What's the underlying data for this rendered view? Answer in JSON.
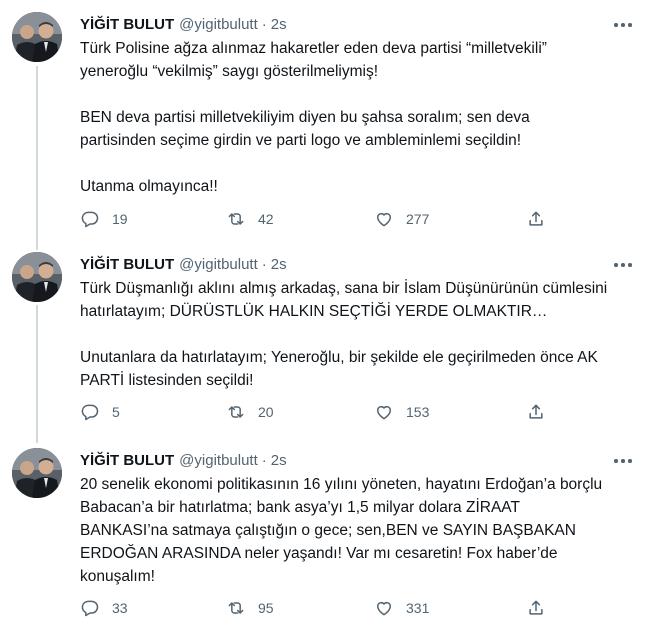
{
  "tweets": [
    {
      "name": "YİĞİT BULUT",
      "handle": "@yigitbulutt",
      "time": "2s",
      "lines": [
        "Türk Polisine ağza alınmaz hakaretler eden deva partisi “milletvekili”",
        "yeneroğlu “vekilmiş” saygı gösterilmeliymiş!",
        "",
        "BEN deva partisi milletvekiliyim diyen bu şahsa soralım; sen deva",
        "partisinden seçime girdin ve parti logo ve ambleminlemi seçildin!",
        "",
        "Utanma olmayınca!!"
      ],
      "replies": "19",
      "retweets": "42",
      "likes": "277"
    },
    {
      "name": "YİĞİT BULUT",
      "handle": "@yigitbulutt",
      "time": "2s",
      "lines": [
        "Türk Düşmanlığı aklını almış arkadaş, sana bir İslam Düşünürünün cümlesini",
        "hatırlatayım; DÜRÜSTLÜK HALKIN SEÇTİĞİ YERDE OLMAKTIR…",
        "",
        "Unutanlara da hatırlatayım; Yeneroğlu, bir şekilde ele geçirilmeden önce AK",
        "PARTİ listesinden seçildi!"
      ],
      "replies": "5",
      "retweets": "20",
      "likes": "153"
    },
    {
      "name": "YİĞİT BULUT",
      "handle": "@yigitbulutt",
      "time": "2s",
      "lines": [
        "20 senelik ekonomi politikasının 16 yılını yöneten, hayatını Erdoğan’a borçlu",
        "Babacan’a bir hatırlatma; bank asya’yı 1,5 milyar dolara ZİRAAT",
        "BANKASI’na satmaya çalıştığın o gece; sen,BEN ve SAYIN BAŞBAKAN",
        "ERDOĞAN ARASINDA neler yaşandı! Var mı cesaretin! Fox haber’de",
        "konuşalım!"
      ],
      "replies": "33",
      "retweets": "95",
      "likes": "331"
    }
  ],
  "icons": {
    "reply": "reply-icon",
    "retweet": "retweet-icon",
    "like": "heart-icon",
    "share": "share-icon",
    "more": "more-icon"
  },
  "colors": {
    "text": "#0f1419",
    "muted": "#536471",
    "thread_line": "#cfd9de"
  }
}
